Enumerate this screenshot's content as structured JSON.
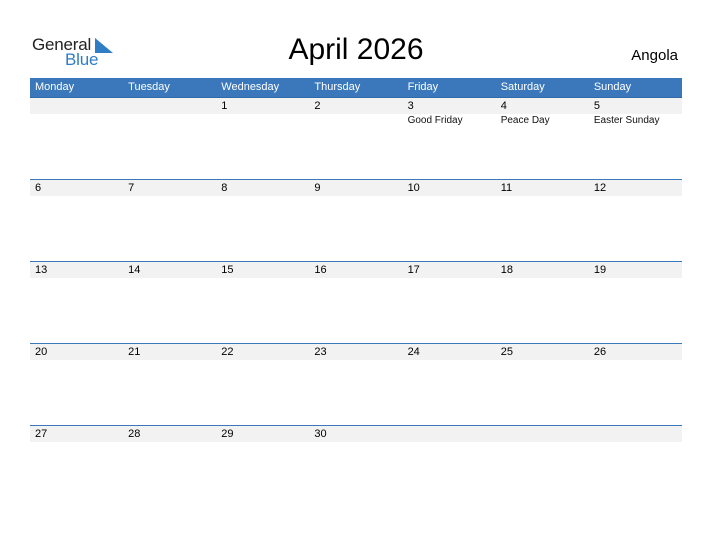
{
  "logo": {
    "line1": "General",
    "line2": "Blue",
    "accent_color": "#2f7dc4"
  },
  "title": "April 2026",
  "country": "Angola",
  "header_color": "#3a78bb",
  "weekdays": [
    "Monday",
    "Tuesday",
    "Wednesday",
    "Thursday",
    "Friday",
    "Saturday",
    "Sunday"
  ],
  "weeks": [
    [
      {
        "day": "",
        "holiday": ""
      },
      {
        "day": "",
        "holiday": ""
      },
      {
        "day": "1",
        "holiday": ""
      },
      {
        "day": "2",
        "holiday": ""
      },
      {
        "day": "3",
        "holiday": "Good Friday"
      },
      {
        "day": "4",
        "holiday": "Peace Day"
      },
      {
        "day": "5",
        "holiday": "Easter Sunday"
      }
    ],
    [
      {
        "day": "6",
        "holiday": ""
      },
      {
        "day": "7",
        "holiday": ""
      },
      {
        "day": "8",
        "holiday": ""
      },
      {
        "day": "9",
        "holiday": ""
      },
      {
        "day": "10",
        "holiday": ""
      },
      {
        "day": "11",
        "holiday": ""
      },
      {
        "day": "12",
        "holiday": ""
      }
    ],
    [
      {
        "day": "13",
        "holiday": ""
      },
      {
        "day": "14",
        "holiday": ""
      },
      {
        "day": "15",
        "holiday": ""
      },
      {
        "day": "16",
        "holiday": ""
      },
      {
        "day": "17",
        "holiday": ""
      },
      {
        "day": "18",
        "holiday": ""
      },
      {
        "day": "19",
        "holiday": ""
      }
    ],
    [
      {
        "day": "20",
        "holiday": ""
      },
      {
        "day": "21",
        "holiday": ""
      },
      {
        "day": "22",
        "holiday": ""
      },
      {
        "day": "23",
        "holiday": ""
      },
      {
        "day": "24",
        "holiday": ""
      },
      {
        "day": "25",
        "holiday": ""
      },
      {
        "day": "26",
        "holiday": ""
      }
    ],
    [
      {
        "day": "27",
        "holiday": ""
      },
      {
        "day": "28",
        "holiday": ""
      },
      {
        "day": "29",
        "holiday": ""
      },
      {
        "day": "30",
        "holiday": ""
      },
      {
        "day": "",
        "holiday": ""
      },
      {
        "day": "",
        "holiday": ""
      },
      {
        "day": "",
        "holiday": ""
      }
    ]
  ]
}
